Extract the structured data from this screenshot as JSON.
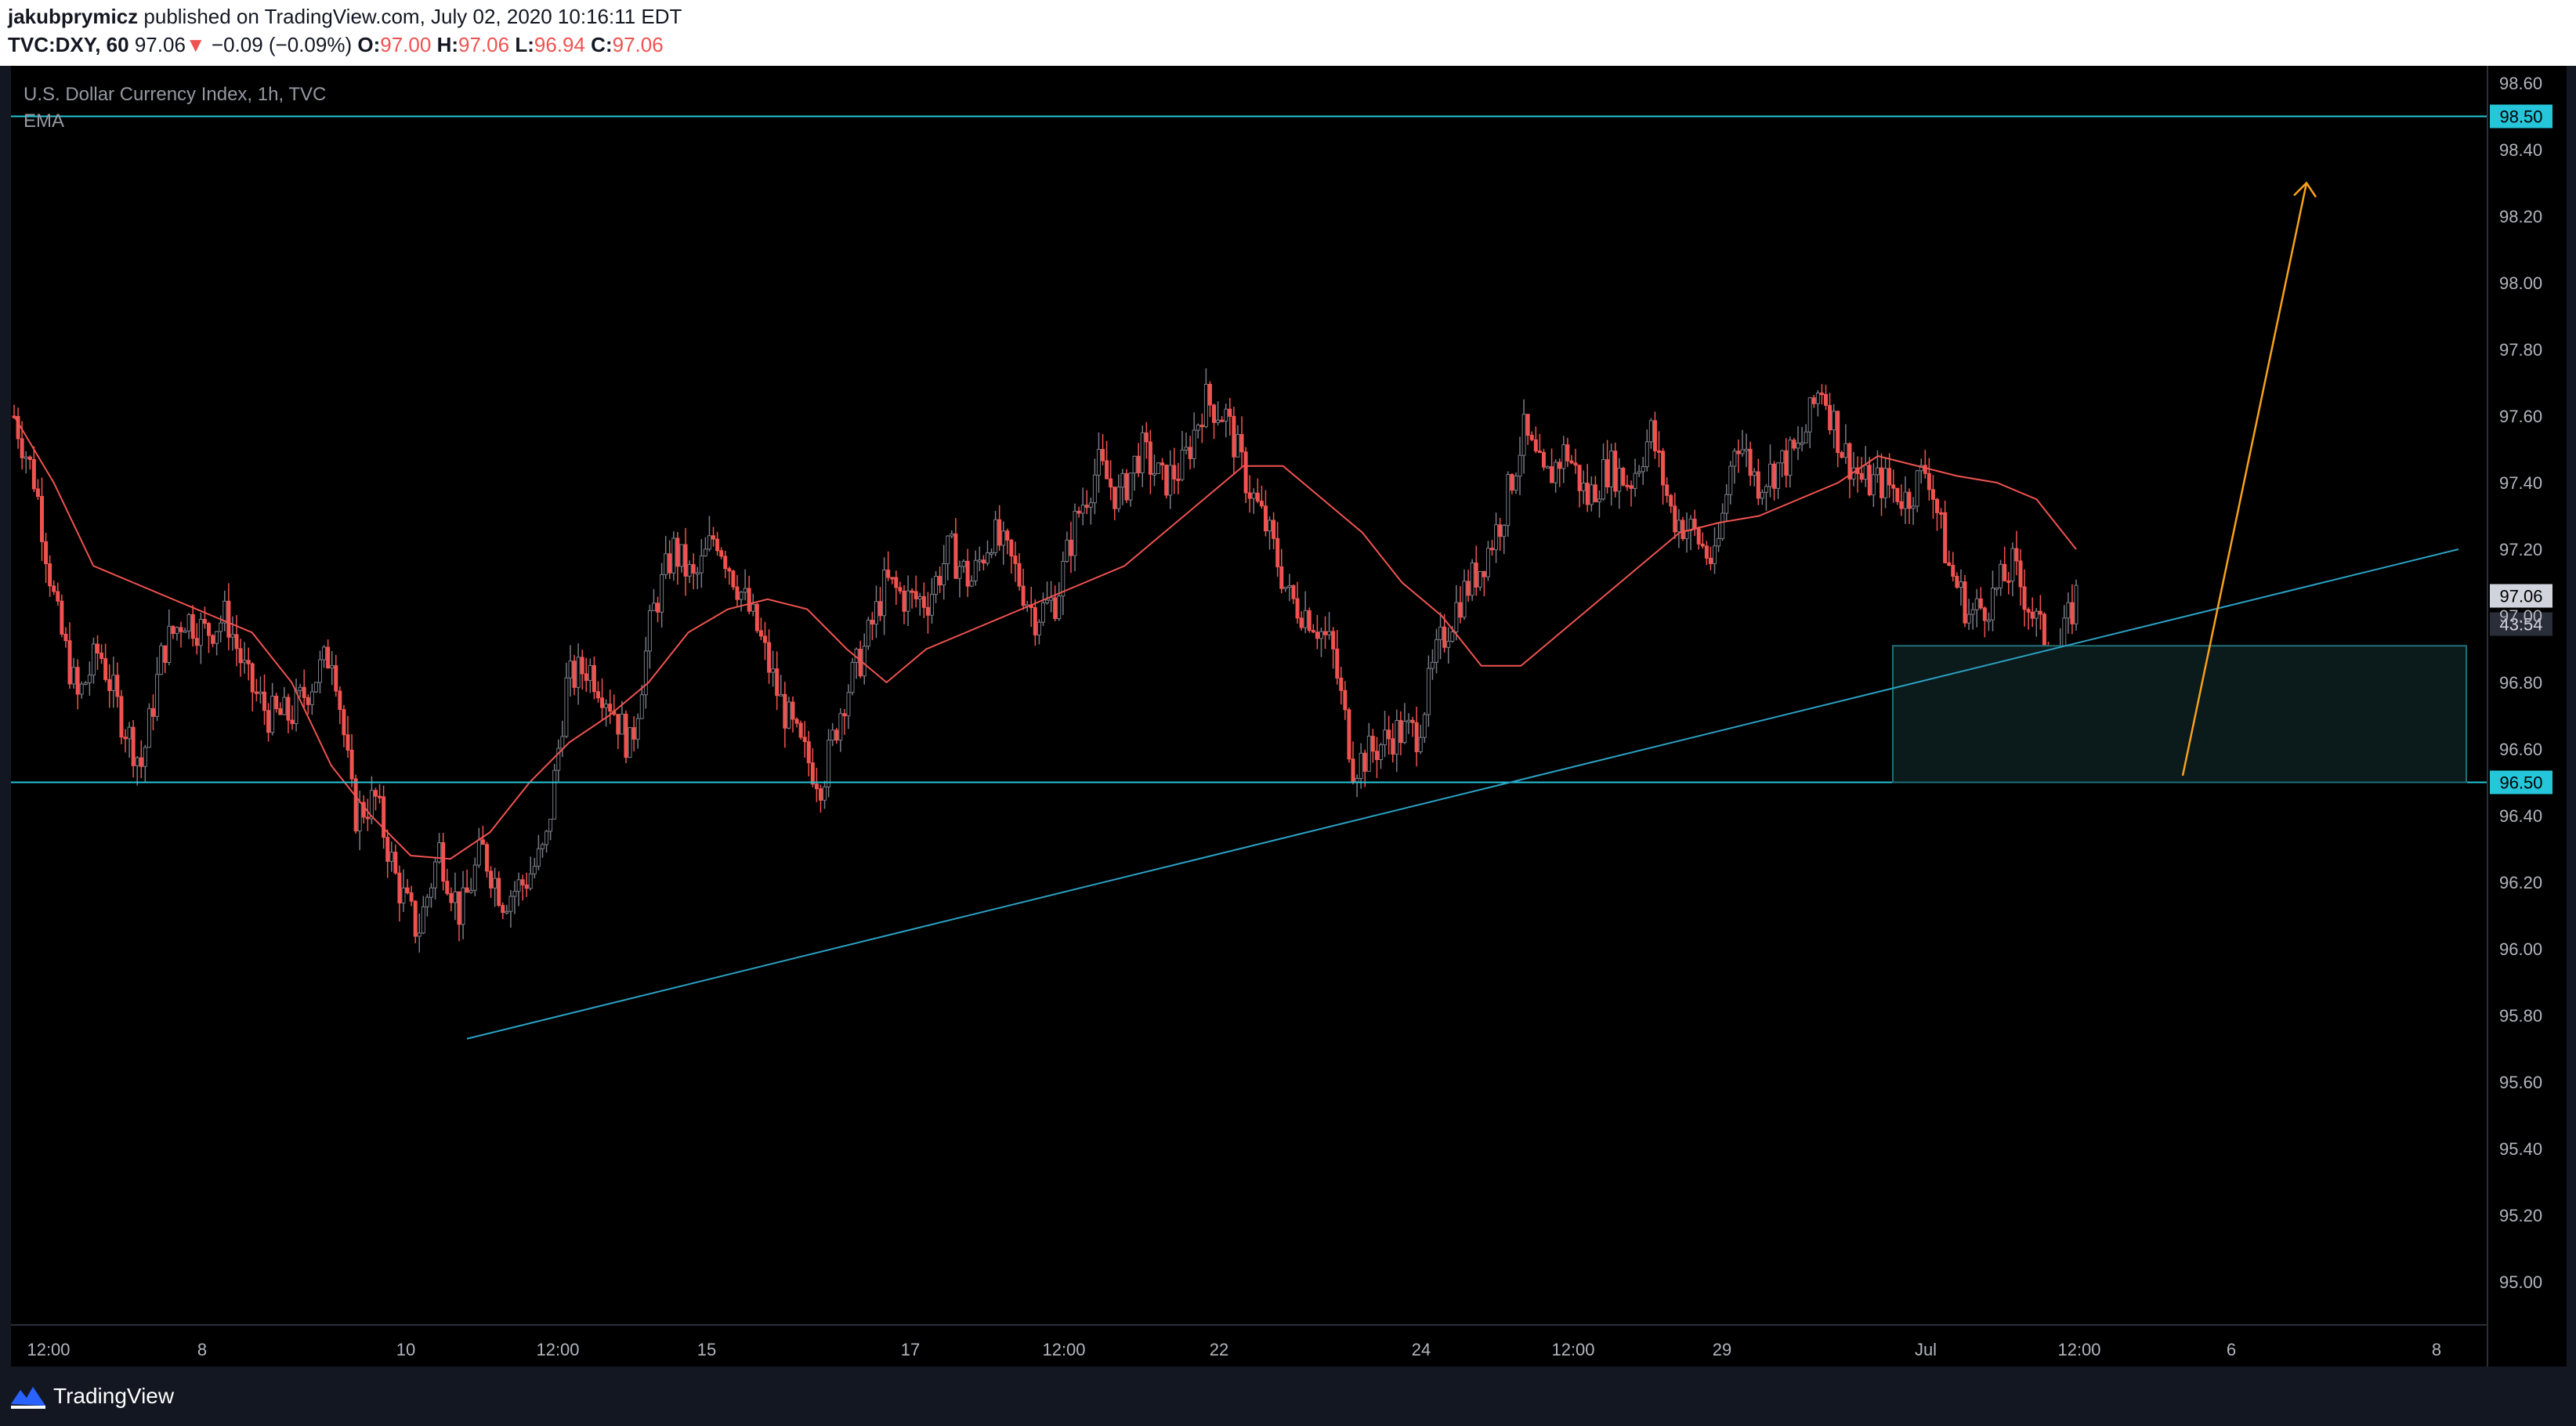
{
  "header": {
    "author": "jakubprymicz",
    "published": " published on TradingView.com, July 02, 2020 10:16:11 EDT",
    "symbol": "TVC:DXY, 60",
    "last": "97.06",
    "arrow": "▼",
    "change": "−0.09 (−0.09%)",
    "open_label": "O:",
    "open": "97.00",
    "high_label": "H:",
    "high": "97.06",
    "low_label": "L:",
    "low": "96.94",
    "close_label": "C:",
    "close": "97.06"
  },
  "legend": {
    "title": "U.S. Dollar Currency Index, 1h, TVC",
    "indicator": "EMA"
  },
  "price_axis": {
    "labels": [
      "98.60",
      "98.40",
      "98.20",
      "98.00",
      "97.80",
      "97.60",
      "97.40",
      "97.20",
      "97.00",
      "96.80",
      "96.60",
      "96.40",
      "96.20",
      "96.00",
      "95.80",
      "95.60",
      "95.40",
      "95.20",
      "95.00"
    ],
    "badges": {
      "resistance": "98.50",
      "support": "96.50",
      "last": "97.06",
      "countdown": "43:54"
    }
  },
  "time_axis": {
    "labels": [
      "12:00",
      "8",
      "10",
      "12:00",
      "15",
      "17",
      "12:00",
      "22",
      "24",
      "12:00",
      "29",
      "Jul",
      "12:00",
      "6",
      "8"
    ]
  },
  "footer": {
    "brand": "TradingView"
  },
  "colors": {
    "background": "#000000",
    "up_candle": "#787b86",
    "down_candle": "#ef5350",
    "ema": "#ef5350",
    "levels": "#26c6da",
    "trendline": "#2ba1c4",
    "projection_arrow": "#f7a21b",
    "zone_fill": "#0b1a1a",
    "zone_border": "#1f6f78"
  },
  "chart_data": {
    "type": "candlestick",
    "title": "U.S. Dollar Currency Index, 1h, TVC",
    "ylim": [
      94.9,
      98.7
    ],
    "x_ticks": [
      "12:00",
      "8",
      "10",
      "12:00",
      "15",
      "17",
      "12:00",
      "22",
      "24",
      "12:00",
      "29",
      "Jul",
      "12:00",
      "6",
      "8"
    ],
    "y_ticks": [
      98.6,
      98.4,
      98.2,
      98.0,
      97.8,
      97.6,
      97.4,
      97.2,
      97.0,
      96.8,
      96.6,
      96.4,
      96.2,
      96.0,
      95.8,
      95.6,
      95.4,
      95.2,
      95.0
    ],
    "close_path": [
      97.6,
      97.4,
      97.0,
      96.75,
      96.9,
      96.7,
      96.55,
      96.9,
      97.0,
      96.95,
      97.0,
      96.8,
      96.7,
      96.7,
      96.8,
      96.9,
      96.4,
      96.45,
      96.2,
      96.05,
      96.3,
      96.1,
      96.3,
      96.15,
      96.2,
      96.3,
      96.8,
      96.85,
      96.75,
      96.6,
      97.0,
      97.2,
      97.1,
      97.25,
      97.1,
      96.95,
      96.75,
      96.6,
      96.5,
      96.75,
      96.9,
      97.1,
      97.05,
      97.05,
      97.2,
      97.1,
      97.25,
      97.15,
      97.0,
      97.05,
      97.3,
      97.45,
      97.35,
      97.5,
      97.4,
      97.45,
      97.65,
      97.6,
      97.4,
      97.25,
      97.05,
      97.0,
      96.9,
      96.55,
      96.6,
      96.65,
      96.65,
      96.9,
      97.05,
      97.15,
      97.3,
      97.55,
      97.4,
      97.5,
      97.35,
      97.45,
      97.4,
      97.55,
      97.3,
      97.25,
      97.15,
      97.55,
      97.4,
      97.45,
      97.5,
      97.7,
      97.5,
      97.4,
      97.4,
      97.35,
      97.45,
      97.15,
      97.0,
      97.05,
      97.15,
      97.0,
      96.85,
      97.06
    ],
    "ema_path": [
      97.6,
      97.4,
      97.15,
      97.1,
      97.05,
      97.0,
      96.95,
      96.8,
      96.55,
      96.4,
      96.28,
      96.27,
      96.35,
      96.5,
      96.62,
      96.7,
      96.8,
      96.95,
      97.02,
      97.05,
      97.02,
      96.9,
      96.8,
      96.9,
      96.95,
      97.0,
      97.05,
      97.1,
      97.15,
      97.25,
      97.35,
      97.45,
      97.45,
      97.35,
      97.25,
      97.1,
      97.0,
      96.85,
      96.85,
      96.95,
      97.05,
      97.15,
      97.25,
      97.28,
      97.3,
      97.35,
      97.4,
      97.48,
      97.45,
      97.42,
      97.4,
      97.35,
      97.2
    ],
    "lines": [
      {
        "kind": "horizontal",
        "value": 98.5
      },
      {
        "kind": "horizontal",
        "value": 96.5
      },
      {
        "kind": "trendline",
        "from": [
          0,
          95.73
        ],
        "to": [
          1,
          97.2
        ]
      },
      {
        "kind": "zone",
        "from": 96.5,
        "to": 96.91
      },
      {
        "kind": "arrow",
        "from": 96.52,
        "to": 98.3
      }
    ]
  }
}
